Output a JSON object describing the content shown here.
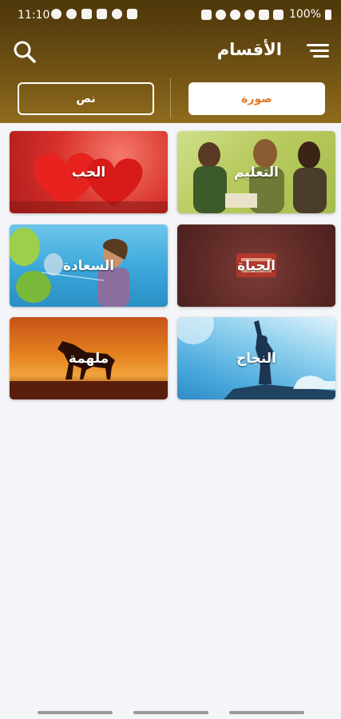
{
  "status_bar": {
    "time": "11:10",
    "battery": "100%"
  },
  "app_bar": {
    "title": "الأقسام"
  },
  "tabs": [
    {
      "label": "صورة",
      "selected": true
    },
    {
      "label": "نص",
      "selected": false
    }
  ],
  "categories": [
    {
      "label": "الحب",
      "icon": "hearts-image"
    },
    {
      "label": "التعليم",
      "icon": "students-image"
    },
    {
      "label": "السعادة",
      "icon": "balloons-girl-image"
    },
    {
      "label": "الحياة",
      "icon": "life-text-image"
    },
    {
      "label": "ملهمة",
      "icon": "horse-sunset-image"
    },
    {
      "label": "النجاح",
      "icon": "climber-summit-image"
    }
  ],
  "colors": {
    "header_dark": "#4e3709",
    "header_light": "#8f6c1e",
    "accent_orange": "#e07b2b",
    "background": "#f4f5f8"
  }
}
